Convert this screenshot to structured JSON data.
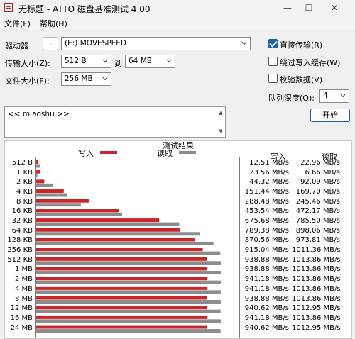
{
  "window": {
    "title": "无标题 - ATTO 磁盘基准测试 4.00"
  },
  "menu": [
    "文件(F)",
    "帮助(H)"
  ],
  "form": {
    "drive_label": "驱动器",
    "browse_label": "...",
    "drive_value": "(E:) MOVESPEED",
    "transfer_label": "传输大小(Z):",
    "transfer_from": "512 B",
    "to_label": "到",
    "transfer_to": "64 MB",
    "file_size_label": "文件大小(F):",
    "file_size": "256 MB"
  },
  "options": {
    "direct_io": {
      "label": "直接传输(R)",
      "checked": true
    },
    "bypass_cache": {
      "label": "绕过写入缓存(W)",
      "checked": false
    },
    "verify": {
      "label": "校验数据(V)",
      "checked": false
    },
    "queue_label": "队列深度(Q):",
    "queue_value": "4",
    "start_label": "开始"
  },
  "description": "<< miaoshu >>",
  "results": {
    "title": "测试结果",
    "write_legend": "写入",
    "read_legend": "读取",
    "write_header": "写入",
    "read_header": "读取",
    "write_color": "#c8262b",
    "read_color": "#8c8c8c"
  },
  "chart_data": {
    "type": "bar",
    "title": "测试结果",
    "orientation": "horizontal",
    "categories": [
      "512 B",
      "1 KB",
      "2 KB",
      "4 KB",
      "8 KB",
      "16 KB",
      "32 KB",
      "64 KB",
      "128 KB",
      "256 KB",
      "512 KB",
      "1 MB",
      "2 MB",
      "4 MB",
      "8 MB",
      "12 MB",
      "16 MB",
      "24 MB"
    ],
    "xlim": [
      0,
      1100
    ],
    "series": [
      {
        "name": "写入",
        "unit": "MB/s",
        "values": [
          12.51,
          23.56,
          44.32,
          151.44,
          288.48,
          453.54,
          675.68,
          789.38,
          870.56,
          915.04,
          938.88,
          938.88,
          941.18,
          941.18,
          938.88,
          940.62,
          941.18,
          940.62
        ],
        "labels": [
          "12.51 MB/s",
          "23.56 MB/s",
          "44.32 MB/s",
          "151.44 MB/s",
          "288.48 MB/s",
          "453.54 MB/s",
          "675.68 MB/s",
          "789.38 MB/s",
          "870.56 MB/s",
          "915.04 MB/s",
          "938.88 MB/s",
          "938.88 MB/s",
          "941.18 MB/s",
          "941.18 MB/s",
          "938.88 MB/s",
          "940.62 MB/s",
          "941.18 MB/s",
          "940.62 MB/s"
        ]
      },
      {
        "name": "读取",
        "unit": "MB/s",
        "values": [
          22.96,
          6.66,
          92.09,
          169.7,
          245.46,
          472.17,
          785.5,
          898.06,
          973.81,
          1011.36,
          1013.86,
          1013.86,
          1013.86,
          1013.86,
          1013.86,
          1012.95,
          1013.86,
          1012.95
        ],
        "labels": [
          "22.96 MB/s",
          "6.66 MB/s",
          "92.09 MB/s",
          "169.70 MB/s",
          "245.46 MB/s",
          "472.17 MB/s",
          "785.50 MB/s",
          "898.06 MB/s",
          "973.81 MB/s",
          "1011.36 MB/s",
          "1013.86 MB/s",
          "1013.86 MB/s",
          "1013.86 MB/s",
          "1013.86 MB/s",
          "1013.86 MB/s",
          "1012.95 MB/s",
          "1013.86 MB/s",
          "1012.95 MB/s"
        ]
      }
    ]
  }
}
